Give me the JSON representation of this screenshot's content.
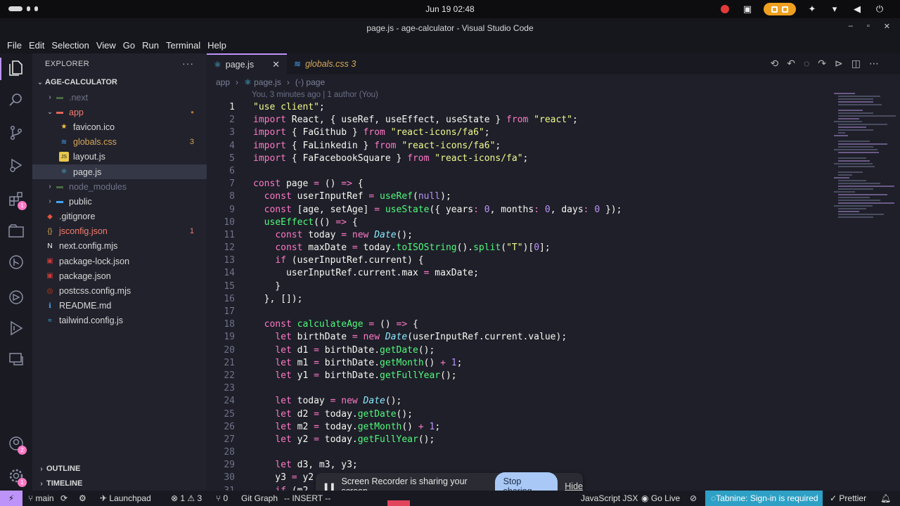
{
  "system": {
    "clock": "Jun 19  02:48"
  },
  "window": {
    "title": "page.js - age-calculator - Visual Studio Code",
    "controls": [
      "–",
      "▫",
      "✕"
    ]
  },
  "menu": [
    "File",
    "Edit",
    "Selection",
    "View",
    "Go",
    "Run",
    "Terminal",
    "Help"
  ],
  "activity_bar": {
    "icons": [
      "explorer-icon",
      "search-icon",
      "source-control-icon",
      "run-debug-icon",
      "extensions-icon",
      "remote-explorer-icon",
      "git-graph-icon",
      "live-share-icon",
      "testing-icon",
      "account-icon",
      "settings-icon"
    ],
    "badges": {
      "extensions": "1",
      "account": "2",
      "settings": "1"
    }
  },
  "sidebar": {
    "header": "EXPLORER",
    "more": "···",
    "project": "AGE-CALCULATOR",
    "tree": [
      {
        "name": ".next",
        "type": "folder",
        "indent": 1,
        "expanded": false,
        "dim": true
      },
      {
        "name": "app",
        "type": "folder",
        "indent": 1,
        "expanded": true,
        "color": "err",
        "dot": "●"
      },
      {
        "name": "favicon.ico",
        "type": "file",
        "indent": 2,
        "icon": "star"
      },
      {
        "name": "globals.css",
        "type": "file",
        "indent": 2,
        "icon": "css",
        "color": "warn",
        "badge": "3"
      },
      {
        "name": "layout.js",
        "type": "file",
        "indent": 2,
        "icon": "js"
      },
      {
        "name": "page.js",
        "type": "file",
        "indent": 2,
        "icon": "react",
        "selected": true
      },
      {
        "name": "node_modules",
        "type": "folder",
        "indent": 1,
        "expanded": false,
        "dim": true
      },
      {
        "name": "public",
        "type": "folder",
        "indent": 1,
        "expanded": false
      },
      {
        "name": ".gitignore",
        "type": "file",
        "indent": 1,
        "icon": "git"
      },
      {
        "name": "jsconfig.json",
        "type": "file",
        "indent": 1,
        "icon": "json",
        "color": "err",
        "badge": "1"
      },
      {
        "name": "next.config.mjs",
        "type": "file",
        "indent": 1,
        "icon": "next"
      },
      {
        "name": "package-lock.json",
        "type": "file",
        "indent": 1,
        "icon": "npm"
      },
      {
        "name": "package.json",
        "type": "file",
        "indent": 1,
        "icon": "npm"
      },
      {
        "name": "postcss.config.mjs",
        "type": "file",
        "indent": 1,
        "icon": "postcss"
      },
      {
        "name": "README.md",
        "type": "file",
        "indent": 1,
        "icon": "info"
      },
      {
        "name": "tailwind.config.js",
        "type": "file",
        "indent": 1,
        "icon": "tailwind"
      }
    ],
    "outline": "OUTLINE",
    "timeline": "TIMELINE"
  },
  "editor": {
    "tabs": [
      {
        "label": "page.js",
        "active": true,
        "close": "✕"
      },
      {
        "label": "globals.css 3",
        "active": false
      }
    ],
    "breadcrumb": [
      "app",
      "page.js",
      "page"
    ],
    "codelens": "You, 3 minutes ago | 1 author (You)",
    "current_line": 1,
    "lines": [
      [
        [
          "s",
          "\"use client\""
        ],
        [
          "v",
          ";"
        ]
      ],
      [
        [
          "k",
          "import"
        ],
        [
          "v",
          " React, { useRef, useEffect, useState } "
        ],
        [
          "k",
          "from"
        ],
        [
          "s",
          " \"react\""
        ],
        [
          "v",
          ";"
        ]
      ],
      [
        [
          "k",
          "import"
        ],
        [
          "v",
          " { FaGithub } "
        ],
        [
          "k",
          "from"
        ],
        [
          "s",
          " \"react-icons/fa6\""
        ],
        [
          "v",
          ";"
        ]
      ],
      [
        [
          "k",
          "import"
        ],
        [
          "v",
          " { FaLinkedin } "
        ],
        [
          "k",
          "from"
        ],
        [
          "s",
          " \"react-icons/fa6\""
        ],
        [
          "v",
          ";"
        ]
      ],
      [
        [
          "k",
          "import"
        ],
        [
          "v",
          " { FaFacebookSquare } "
        ],
        [
          "k",
          "from"
        ],
        [
          "s",
          " \"react-icons/fa\""
        ],
        [
          "v",
          ";"
        ]
      ],
      [],
      [
        [
          "k",
          "const"
        ],
        [
          "v",
          " page "
        ],
        [
          "o",
          "="
        ],
        [
          "v",
          " () "
        ],
        [
          "o",
          "=>"
        ],
        [
          "v",
          " {"
        ]
      ],
      [
        [
          "v",
          "  "
        ],
        [
          "k",
          "const"
        ],
        [
          "v",
          " userInputRef "
        ],
        [
          "o",
          "="
        ],
        [
          "f",
          " useRef"
        ],
        [
          "v",
          "("
        ],
        [
          "c",
          "null"
        ],
        [
          "v",
          ");"
        ]
      ],
      [
        [
          "v",
          "  "
        ],
        [
          "k",
          "const"
        ],
        [
          "v",
          " [age, setAge] "
        ],
        [
          "o",
          "="
        ],
        [
          "f",
          " useState"
        ],
        [
          "v",
          "({ years"
        ],
        [
          "o",
          ":"
        ],
        [
          "c",
          " 0"
        ],
        [
          "v",
          ", months"
        ],
        [
          "o",
          ":"
        ],
        [
          "c",
          " 0"
        ],
        [
          "v",
          ", days"
        ],
        [
          "o",
          ":"
        ],
        [
          "c",
          " 0"
        ],
        [
          "v",
          " });"
        ]
      ],
      [
        [
          "v",
          "  "
        ],
        [
          "f",
          "useEffect"
        ],
        [
          "v",
          "(() "
        ],
        [
          "o",
          "=>"
        ],
        [
          "v",
          " {"
        ]
      ],
      [
        [
          "v",
          "    "
        ],
        [
          "k",
          "const"
        ],
        [
          "v",
          " today "
        ],
        [
          "o",
          "="
        ],
        [
          "k",
          " new"
        ],
        [
          "p",
          " Date"
        ],
        [
          "v",
          "();"
        ]
      ],
      [
        [
          "v",
          "    "
        ],
        [
          "k",
          "const"
        ],
        [
          "v",
          " maxDate "
        ],
        [
          "o",
          "="
        ],
        [
          "v",
          " today."
        ],
        [
          "f",
          "toISOString"
        ],
        [
          "v",
          "()."
        ],
        [
          "f",
          "split"
        ],
        [
          "v",
          "("
        ],
        [
          "s",
          "\"T\""
        ],
        [
          "v",
          ")["
        ],
        [
          "c",
          "0"
        ],
        [
          "v",
          "];"
        ]
      ],
      [
        [
          "v",
          "    "
        ],
        [
          "k",
          "if"
        ],
        [
          "v",
          " (userInputRef.current) {"
        ]
      ],
      [
        [
          "v",
          "      userInputRef.current.max "
        ],
        [
          "o",
          "="
        ],
        [
          "v",
          " maxDate;"
        ]
      ],
      [
        [
          "v",
          "    }"
        ]
      ],
      [
        [
          "v",
          "  }, []);"
        ]
      ],
      [],
      [
        [
          "v",
          "  "
        ],
        [
          "k",
          "const"
        ],
        [
          "f",
          " calculateAge"
        ],
        [
          "o",
          " ="
        ],
        [
          "v",
          " () "
        ],
        [
          "o",
          "=>"
        ],
        [
          "v",
          " {"
        ]
      ],
      [
        [
          "v",
          "    "
        ],
        [
          "k",
          "let"
        ],
        [
          "v",
          " birthDate "
        ],
        [
          "o",
          "="
        ],
        [
          "k",
          " new"
        ],
        [
          "p",
          " Date"
        ],
        [
          "v",
          "(userInputRef.current.value);"
        ]
      ],
      [
        [
          "v",
          "    "
        ],
        [
          "k",
          "let"
        ],
        [
          "v",
          " d1 "
        ],
        [
          "o",
          "="
        ],
        [
          "v",
          " birthDate."
        ],
        [
          "f",
          "getDate"
        ],
        [
          "v",
          "();"
        ]
      ],
      [
        [
          "v",
          "    "
        ],
        [
          "k",
          "let"
        ],
        [
          "v",
          " m1 "
        ],
        [
          "o",
          "="
        ],
        [
          "v",
          " birthDate."
        ],
        [
          "f",
          "getMonth"
        ],
        [
          "v",
          "() "
        ],
        [
          "o",
          "+"
        ],
        [
          "c",
          " 1"
        ],
        [
          "v",
          ";"
        ]
      ],
      [
        [
          "v",
          "    "
        ],
        [
          "k",
          "let"
        ],
        [
          "v",
          " y1 "
        ],
        [
          "o",
          "="
        ],
        [
          "v",
          " birthDate."
        ],
        [
          "f",
          "getFullYear"
        ],
        [
          "v",
          "();"
        ]
      ],
      [],
      [
        [
          "v",
          "    "
        ],
        [
          "k",
          "let"
        ],
        [
          "v",
          " today "
        ],
        [
          "o",
          "="
        ],
        [
          "k",
          " new"
        ],
        [
          "p",
          " Date"
        ],
        [
          "v",
          "();"
        ]
      ],
      [
        [
          "v",
          "    "
        ],
        [
          "k",
          "let"
        ],
        [
          "v",
          " d2 "
        ],
        [
          "o",
          "="
        ],
        [
          "v",
          " today."
        ],
        [
          "f",
          "getDate"
        ],
        [
          "v",
          "();"
        ]
      ],
      [
        [
          "v",
          "    "
        ],
        [
          "k",
          "let"
        ],
        [
          "v",
          " m2 "
        ],
        [
          "o",
          "="
        ],
        [
          "v",
          " today."
        ],
        [
          "f",
          "getMonth"
        ],
        [
          "v",
          "() "
        ],
        [
          "o",
          "+"
        ],
        [
          "c",
          " 1"
        ],
        [
          "v",
          ";"
        ]
      ],
      [
        [
          "v",
          "    "
        ],
        [
          "k",
          "let"
        ],
        [
          "v",
          " y2 "
        ],
        [
          "o",
          "="
        ],
        [
          "v",
          " today."
        ],
        [
          "f",
          "getFullYear"
        ],
        [
          "v",
          "();"
        ]
      ],
      [],
      [
        [
          "v",
          "    "
        ],
        [
          "k",
          "let"
        ],
        [
          "v",
          " d3, m3, y3;"
        ]
      ],
      [
        [
          "v",
          "    y3 "
        ],
        [
          "o",
          "="
        ],
        [
          "v",
          " y2"
        ]
      ],
      [
        [
          "v",
          "    "
        ],
        [
          "k",
          "if"
        ],
        [
          "v",
          " (m2"
        ]
      ]
    ]
  },
  "recorder": {
    "message": "Screen Recorder is sharing your screen.",
    "stop": "Stop sharing",
    "hide": "Hide"
  },
  "statusbar": {
    "remote": "⚡",
    "branch": "main",
    "launchpad": "Launchpad",
    "errors": "1",
    "warnings": "3",
    "ports": "0",
    "git_graph": "Git Graph",
    "mode": "-- INSERT --",
    "language": "JavaScript JSX",
    "golive": "Go Live",
    "tabnine": "Tabnine: Sign-in is required",
    "prettier": "Prettier"
  },
  "colors": {
    "accent": "#bd93f9",
    "editor_bg": "#1e1f29",
    "sidebar_bg": "#21222c",
    "tabnine": "#2ea0c6"
  }
}
